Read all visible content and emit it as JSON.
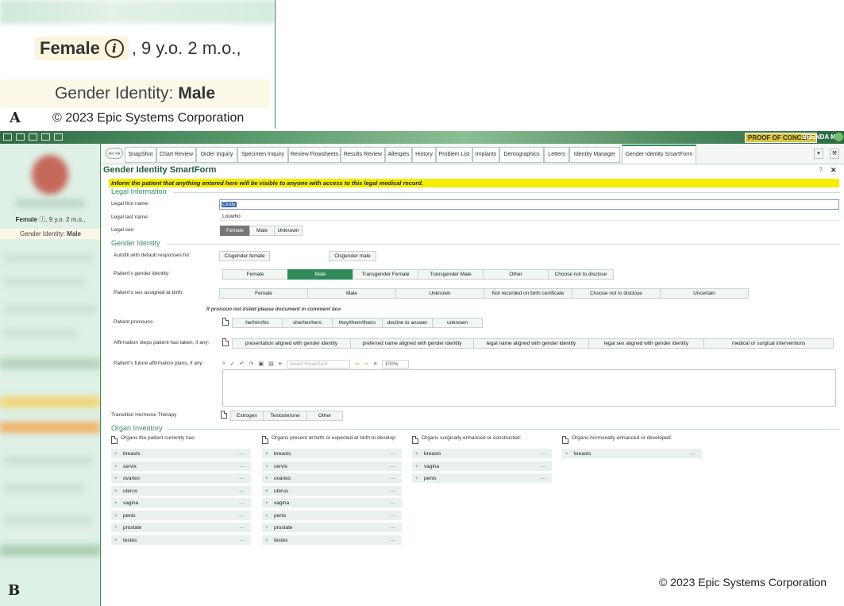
{
  "panelA": {
    "sex": "Female",
    "age": ", 9 y.o. 2 m.o.,",
    "gender_identity_label": "Gender Identity:",
    "gender_identity_value": "Male",
    "panel_label": "A",
    "copyright": "© 2023 Epic Systems Corporation"
  },
  "topbar": {
    "poc": "PROOF OF CONCEPT",
    "user": "BRENDA M."
  },
  "sidebar": {
    "sex": "Female",
    "age": ", 9 y.o. 2 m.o.,",
    "gender_identity_label": "Gender Identity:",
    "gender_identity_value": "Male"
  },
  "tabs": [
    "SnapShot",
    "Chart Review",
    "Order Inquiry",
    "Specimen Inquiry",
    "Review Flowsheets",
    "Results Review",
    "Allergies",
    "History",
    "Problem List",
    "Implants",
    "Demographics",
    "Letters",
    "Identity Manager",
    "Gender Identity SmartForm"
  ],
  "form": {
    "title": "Gender Identity SmartForm",
    "warning": "Inform the patient that anything entered here will be visible to anyone with access to this legal medical record.",
    "legal_section": "Legal Information",
    "legal_first_label": "Legal first name:",
    "legal_first_value": "Cindy",
    "legal_last_label": "Legal last name:",
    "legal_last_value": "Louwho",
    "legal_sex_label": "Legal sex:",
    "legal_sex_options": [
      "Female",
      "Male",
      "Unknown"
    ],
    "gi_section": "Gender Identity",
    "autofill_label": "Autofill with default responses for:",
    "autofill_options": [
      "Cisgender female",
      "Cisgender male"
    ],
    "gi_label": "Patient's gender identity:",
    "gi_options": [
      "Female",
      "Male",
      "Transgender Female",
      "Transgender Male",
      "Other",
      "Choose not to disclose"
    ],
    "sab_label": "Patient's sex assigned at birth:",
    "sab_options": [
      "Female",
      "Male",
      "Unknown",
      "Not recorded on birth certificate",
      "Choose not to disclose",
      "Uncertain"
    ],
    "pronoun_note": "If pronoun not listed please document in comment box",
    "pronoun_label": "Patient pronouns:",
    "pronoun_options": [
      "he/him/his",
      "she/her/hers",
      "they/them/theirs",
      "decline to answer",
      "unknown"
    ],
    "affirm_label": "Affirmation steps patient has taken, if any:",
    "affirm_options": [
      "presentation aligned with gender identity",
      "preferred name aligned with gender identity",
      "legal name aligned with gender identity",
      "legal sex aligned with gender identity",
      "medical or surgical interventions"
    ],
    "future_label": "Patient's future affirmation plans, if any:",
    "smarttext_placeholder": "Insert SmartText",
    "zoom": "100%",
    "hormone_label": "Transition Hormone Therapy",
    "hormone_options": [
      "Estrogen",
      "Testosterone",
      "Other"
    ],
    "organ_section": "Organ Inventory",
    "organ_cols": [
      {
        "head": "Organs the patient currently has:",
        "items": [
          "breasts",
          "cervix",
          "ovaries",
          "uterus",
          "vagina",
          "penis",
          "prostate",
          "testes"
        ]
      },
      {
        "head": "Organs present at birth or expected at birth to develop:",
        "items": [
          "breasts",
          "cervix",
          "ovaries",
          "uterus",
          "vagina",
          "penis",
          "prostate",
          "testes"
        ]
      },
      {
        "head": "Organs surgically enhanced or constructed:",
        "items": [
          "breasts",
          "vagina",
          "penis"
        ]
      },
      {
        "head": "Organs hormonally enhanced or developed:",
        "items": [
          "breasts"
        ]
      }
    ]
  },
  "panelB": {
    "panel_label": "B",
    "copyright": "© 2023 Epic Systems Corporation"
  },
  "colors": {
    "accent": "#2f8a5a",
    "warning": "#f5ed00",
    "header": "#2f6b45"
  }
}
